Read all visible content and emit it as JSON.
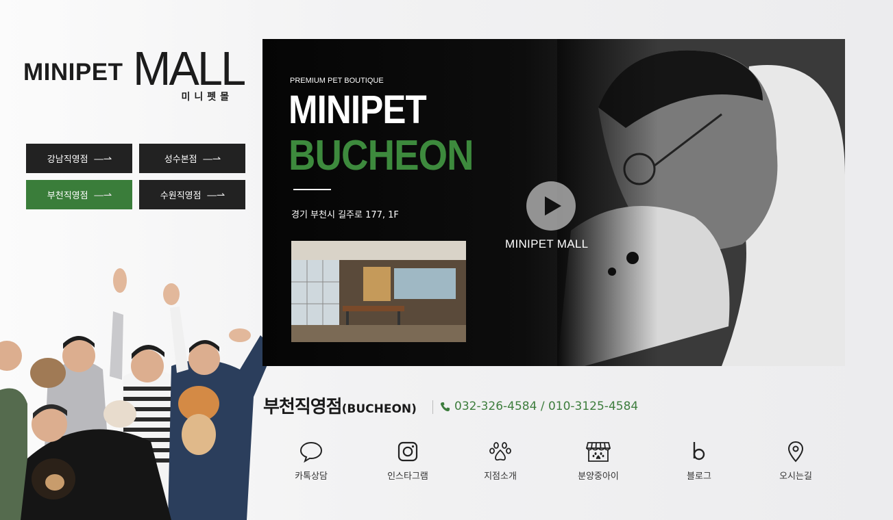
{
  "logo": {
    "primary": "MINIPET",
    "secondary": "MALL",
    "korean": "미니펫몰"
  },
  "branches": [
    {
      "label": "강남직영점",
      "active": false
    },
    {
      "label": "성수본점",
      "active": false
    },
    {
      "label": "부천직영점",
      "active": true
    },
    {
      "label": "수원직영점",
      "active": false
    }
  ],
  "banner": {
    "subtitle": "PREMIUM PET BOUTIQUE",
    "title_line1": "MINIPET",
    "title_line2": "BUCHEON",
    "address": "경기 부천시 길주로 177, 1F",
    "play_label": "MINIPET MALL",
    "play_icon": "play-icon"
  },
  "store": {
    "name": "부천직영점",
    "name_en": "(BUCHEON)",
    "phone": "032-326-4584 / 010-3125-4584",
    "phone_icon": "phone-icon"
  },
  "quick_links": [
    {
      "label": "카톡상담",
      "icon": "chat-bubble-icon"
    },
    {
      "label": "인스타그램",
      "icon": "instagram-icon"
    },
    {
      "label": "지점소개",
      "icon": "paw-icon"
    },
    {
      "label": "분양중아이",
      "icon": "shop-icon"
    },
    {
      "label": "블로그",
      "icon": "blog-icon"
    },
    {
      "label": "오시는길",
      "icon": "location-pin-icon"
    }
  ],
  "colors": {
    "accent": "#3a7d3a",
    "dark_button": "#222222",
    "phone": "#3d7d3d"
  }
}
